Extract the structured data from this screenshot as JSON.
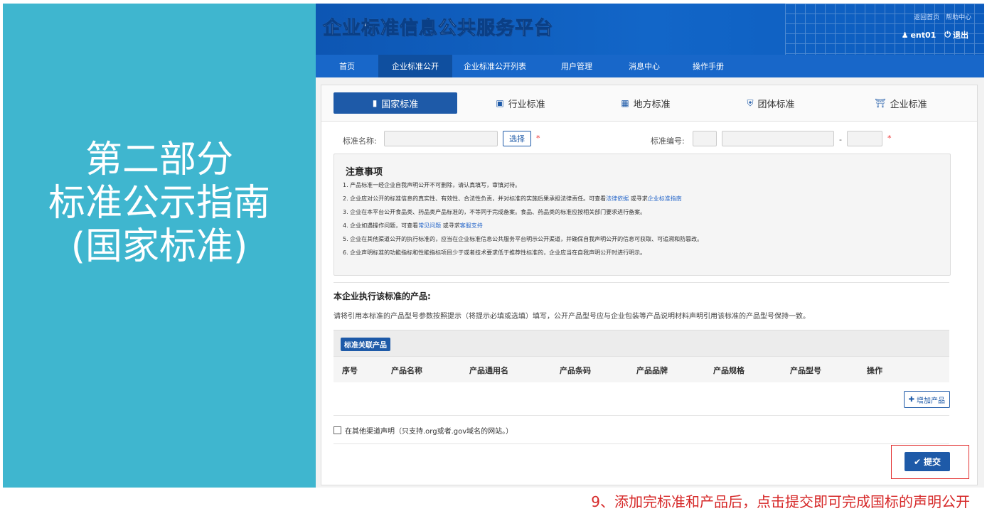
{
  "slide": {
    "title_lines": [
      "第二部分",
      "标准公示指南",
      "(国家标准)"
    ],
    "caption": "9、添加完标准和产品后，点击提交即可完成国标的声明公开"
  },
  "header": {
    "logo_title": "企业标准信息公共服务平台",
    "link_home": "返回首页",
    "link_help": "帮助中心",
    "username": "ent01",
    "logout": "退出"
  },
  "nav": {
    "items": [
      "首页",
      "企业标准公开",
      "企业标准公开列表",
      "用户管理",
      "消息中心",
      "操作手册"
    ],
    "active_index": 1
  },
  "tabs": {
    "items": [
      "国家标准",
      "行业标准",
      "地方标准",
      "团体标准",
      "企业标准"
    ],
    "active_index": 0
  },
  "form": {
    "std_name_label": "标准名称:",
    "select_button": "选择",
    "std_no_label": "标准编号:",
    "dash": "-",
    "required_mark": "*"
  },
  "notice": {
    "title": "注意事项",
    "item1": "1. 产品标准一经企业自我声明公开不可删除，请认真填写，审慎对待。",
    "item2_pre": "2. 企业应对公开的标准信息的真实性、有效性、合法性负责，并对标准的实施后果承担法律责任。可查看",
    "item2_link1": "法律依据",
    "item2_mid": " 或寻求",
    "item2_link2": "企业标准指南",
    "item3": "3. 企业在本平台公开食品类、药品类产品标准的，不等同于完成备案。食品、药品类的标准应按相关部门要求进行备案。",
    "item4_pre": "4. 企业如遇操作问题，可查看",
    "item4_link1": "常见问题",
    "item4_mid": " 或寻求",
    "item4_link2": "客服支持",
    "item5": "5. 企业在其他渠道公开的执行标准的，应当在企业标准信息公共服务平台明示公开渠道，并确保自我声明公开的信息可获取、可追溯和防篡改。",
    "item6": "6. 企业声明标准的功能指标和性能指标项目少于或者技术要求低于推荐性标准的，企业应当在自我声明公开时进行明示。"
  },
  "products": {
    "section_title": "本企业执行该标准的产品:",
    "section_desc": "请将引用本标准的产品型号参数按照提示（将提示必填或选填）填写，公开产品型号应与企业包装等产品说明材料声明引用该标准的产品型号保持一致。",
    "badge": "标准关联产品",
    "columns": [
      "序号",
      "产品名称",
      "产品通用名",
      "产品条码",
      "产品品牌",
      "产品规格",
      "产品型号",
      "操作"
    ],
    "add_button": "增加产品"
  },
  "other_channel": {
    "label": "在其他渠道声明（只支持.org或者.gov域名的网站。）"
  },
  "submit": {
    "label": "提交"
  },
  "colors": {
    "slide_panel": "#3fb6cf",
    "header_blue": "#1266c8",
    "accent_blue": "#1e5aa8",
    "caption_red": "#d62828"
  }
}
